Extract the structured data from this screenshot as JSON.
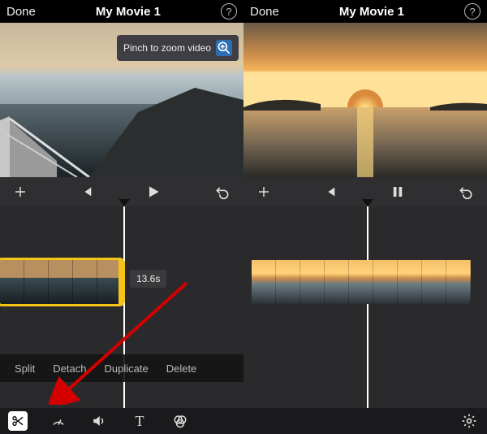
{
  "left": {
    "header": {
      "done": "Done",
      "title": "My Movie 1"
    },
    "pinch_tip": "Pinch to zoom video",
    "duration": "13.6s",
    "context_menu": {
      "split": "Split",
      "detach": "Detach",
      "duplicate": "Duplicate",
      "delete": "Delete"
    }
  },
  "right": {
    "header": {
      "done": "Done",
      "title": "My Movie 1"
    }
  }
}
